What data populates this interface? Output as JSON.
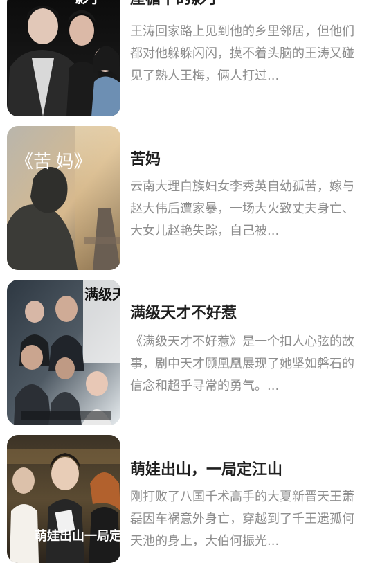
{
  "dramas": [
    {
      "title": "屋檐下的影子",
      "cover_text": "影子",
      "description": "王涛回家路上见到他的乡里邻居，但他们都对他躲躲闪闪，摸不着头脑的王涛又碰见了熟人王梅，俩人打过..."
    },
    {
      "title": "苦妈",
      "cover_text": "《苦 妈》",
      "description": "云南大理白族妇女李秀英自幼孤苦，嫁与赵大伟后遭家暴，一场大火致丈夫身亡、大女儿赵艳失踪，自己被..."
    },
    {
      "title": "满级天才不好惹",
      "cover_text": "满级天才不好惹",
      "description": "《满级天才不好惹》是一个扣人心弦的故事，剧中天才顾凰凰展现了她坚如磐石的信念和超乎寻常的勇气。..."
    },
    {
      "title": "萌娃出山，一局定江山",
      "cover_text": "萌娃出山一局定江山",
      "description": "刚打败了八国千术高手的大夏新晋天王萧磊因车祸意外身亡，穿越到了千王遗孤何天池的身上，大伯何振光..."
    }
  ]
}
